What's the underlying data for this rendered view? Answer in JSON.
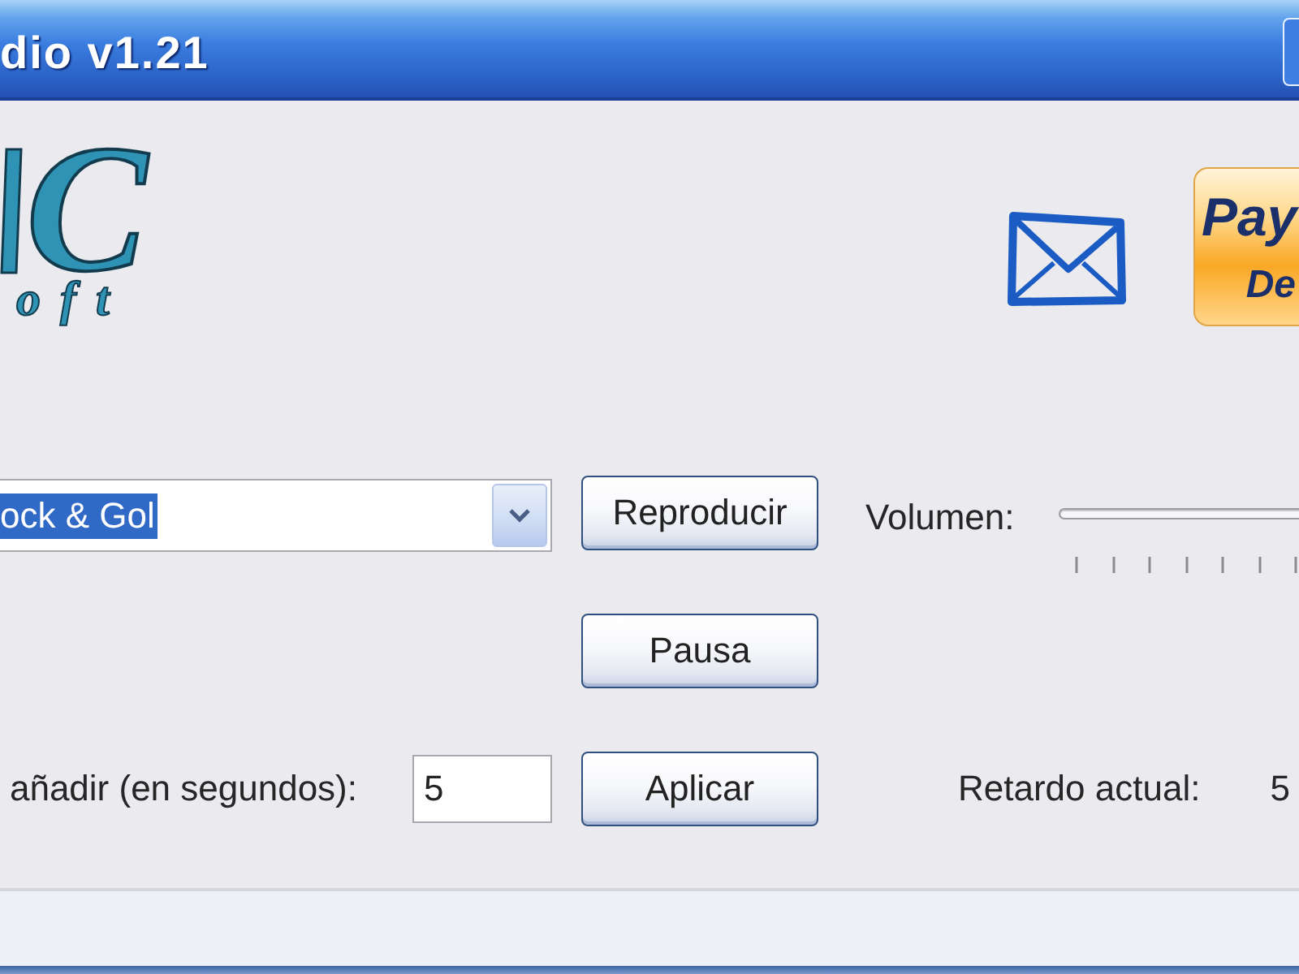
{
  "window": {
    "title": "dio v1.21"
  },
  "logo": {
    "mark": "C",
    "wordmark": "oft"
  },
  "donate_button": {
    "line_1": "Pay",
    "line_2": "De"
  },
  "station_combo": {
    "value": "ock & Gol",
    "text_selected": true
  },
  "play_button": {
    "label": "Reproducir"
  },
  "volume": {
    "label": "Volumen:"
  },
  "pause_button": {
    "label": "Pausa"
  },
  "delay": {
    "label": "añadir (en segundos):",
    "value": "5",
    "apply_button": "Aplicar",
    "current_label": "Retardo actual:",
    "current_value": "5"
  }
}
